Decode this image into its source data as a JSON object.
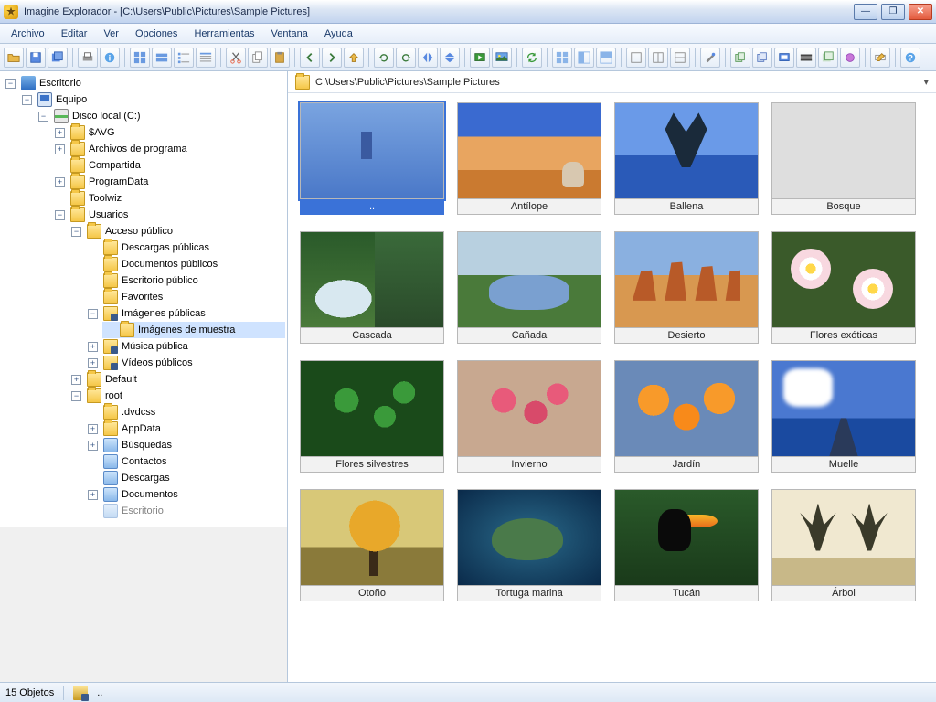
{
  "title": "Imagine Explorador - [C:\\Users\\Public\\Pictures\\Sample Pictures]",
  "menu": [
    "Archivo",
    "Editar",
    "Ver",
    "Opciones",
    "Herramientas",
    "Ventana",
    "Ayuda"
  ],
  "path": "C:\\Users\\Public\\Pictures\\Sample Pictures",
  "tree": {
    "root": "Escritorio",
    "equipo": "Equipo",
    "disk": "Disco local (C:)",
    "c": [
      "$AVG",
      "Archivos de programa",
      "Compartida",
      "ProgramData",
      "Toolwiz",
      "Usuarios"
    ],
    "usuarios": [
      "Acceso público",
      "Default",
      "root"
    ],
    "acceso": [
      "Descargas públicas",
      "Documentos públicos",
      "Escritorio público",
      "Favorites",
      "Imágenes públicas",
      "Música pública",
      "Vídeos públicos"
    ],
    "imagenes_child": "Imágenes de muestra",
    "root_children": [
      ".dvdcss",
      "AppData",
      "Búsquedas",
      "Contactos",
      "Descargas",
      "Documentos",
      "Escritorio"
    ]
  },
  "thumbs": [
    {
      "name": "..",
      "art": "art-parent",
      "selected": true
    },
    {
      "name": "Antílope",
      "art": "art-antilope"
    },
    {
      "name": "Ballena",
      "art": "art-ballena"
    },
    {
      "name": "Bosque",
      "art": "art-bosque"
    },
    {
      "name": "Cascada",
      "art": "art-cascada"
    },
    {
      "name": "Cañada",
      "art": "art-canada"
    },
    {
      "name": "Desierto",
      "art": "art-desierto"
    },
    {
      "name": "Flores exóticas",
      "art": "art-flores-ex"
    },
    {
      "name": "Flores silvestres",
      "art": "art-flores-sil"
    },
    {
      "name": "Invierno",
      "art": "art-invierno"
    },
    {
      "name": "Jardín",
      "art": "art-jardin"
    },
    {
      "name": "Muelle",
      "art": "art-muelle"
    },
    {
      "name": "Otoño",
      "art": "art-otono"
    },
    {
      "name": "Tortuga marina",
      "art": "art-tortuga"
    },
    {
      "name": "Tucán",
      "art": "art-tucan"
    },
    {
      "name": "Árbol",
      "art": "art-arbol"
    }
  ],
  "status": {
    "count": "15 Objetos",
    "sel": ".."
  }
}
